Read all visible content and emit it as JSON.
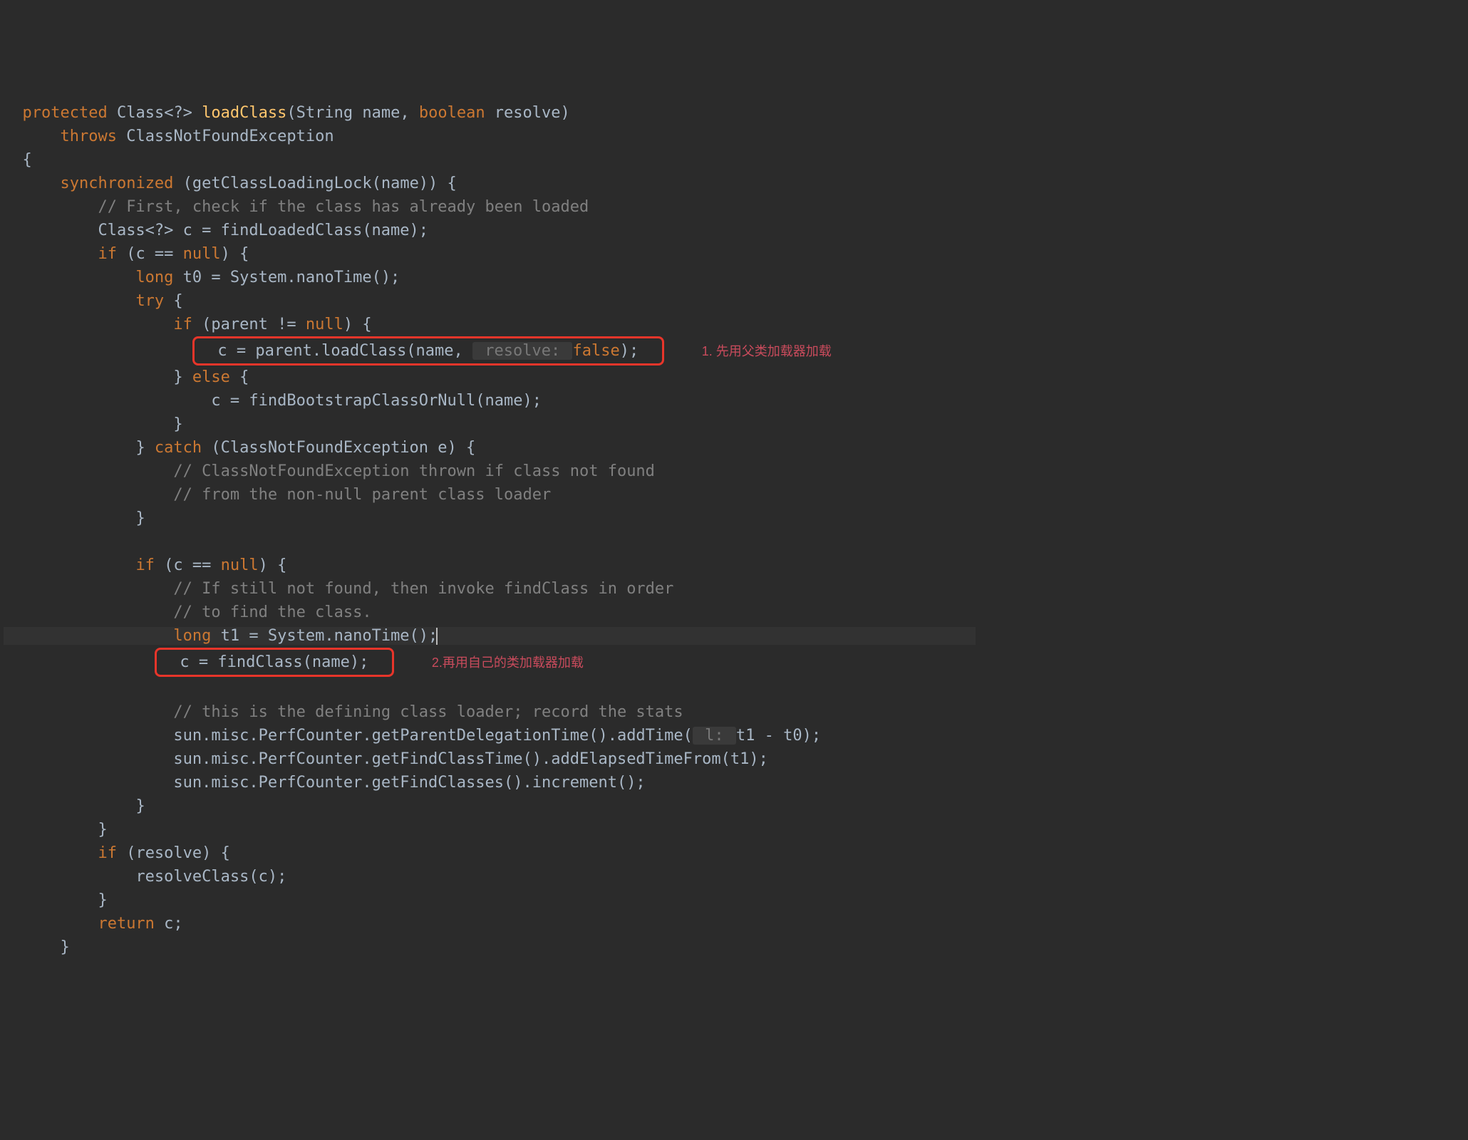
{
  "code": {
    "sig_protected": "protected",
    "sig_class": "Class<?> ",
    "sig_method": "loadClass",
    "sig_params": "(String name, ",
    "sig_boolean": "boolean",
    "sig_params2": " resolve)",
    "throws_kw": "throws",
    "throws_ex": " ClassNotFoundException",
    "brace_open": "{",
    "sync_kw": "synchronized",
    "sync_expr": " (getClassLoadingLock(name)) {",
    "c_first": "// First, check if the class has already been loaded",
    "decl_c": "Class<?> c = findLoadedClass(name);",
    "if_kw": "if",
    "if_cnull_1": " (c == ",
    "null_kw": "null",
    "if_cnull_2": ") {",
    "long_kw": "long",
    "t0_decl": " t0 = System.nanoTime();",
    "try_kw": "try",
    "try_brace": " {",
    "if_parent_1": " (parent != ",
    "if_parent_2": ") {",
    "parent_load_1": "c = parent.loadClass(name, ",
    "hint_resolve": " resolve: ",
    "false_kw": "false",
    "parent_load_2": ");",
    "brace_close": "}",
    "else_kw": " else ",
    "else_brace": "{",
    "find_boot": "c = findBootstrapClassOrNull(name);",
    "catch_kw": " catch ",
    "catch_sig": "(ClassNotFoundException e) {",
    "c_cnfe1": "// ClassNotFoundException thrown if class not found",
    "c_cnfe2": "// from the non-null parent class loader",
    "c_still1": "// If still not found, then invoke findClass in order",
    "c_still2": "// to find the class.",
    "t1_decl": " t1 = System.nanoTime();",
    "find_class": "c = findClass(name);",
    "c_stats": "// this is the defining class loader; record the stats",
    "perf1_a": "sun.misc.PerfCounter.getParentDelegationTime().addTime(",
    "hint_l": " l: ",
    "perf1_b": "t1 - t0);",
    "perf2": "sun.misc.PerfCounter.getFindClassTime().addElapsedTimeFrom(t1);",
    "perf3": "sun.misc.PerfCounter.getFindClasses().increment();",
    "if_resolve": " (resolve) {",
    "resolve_call": "resolveClass(c);",
    "return_kw": "return",
    "return_c": " c;"
  },
  "annotations": {
    "a1": "1. 先用父类加载器加载",
    "a2": "2.再用自己的类加载器加载"
  }
}
